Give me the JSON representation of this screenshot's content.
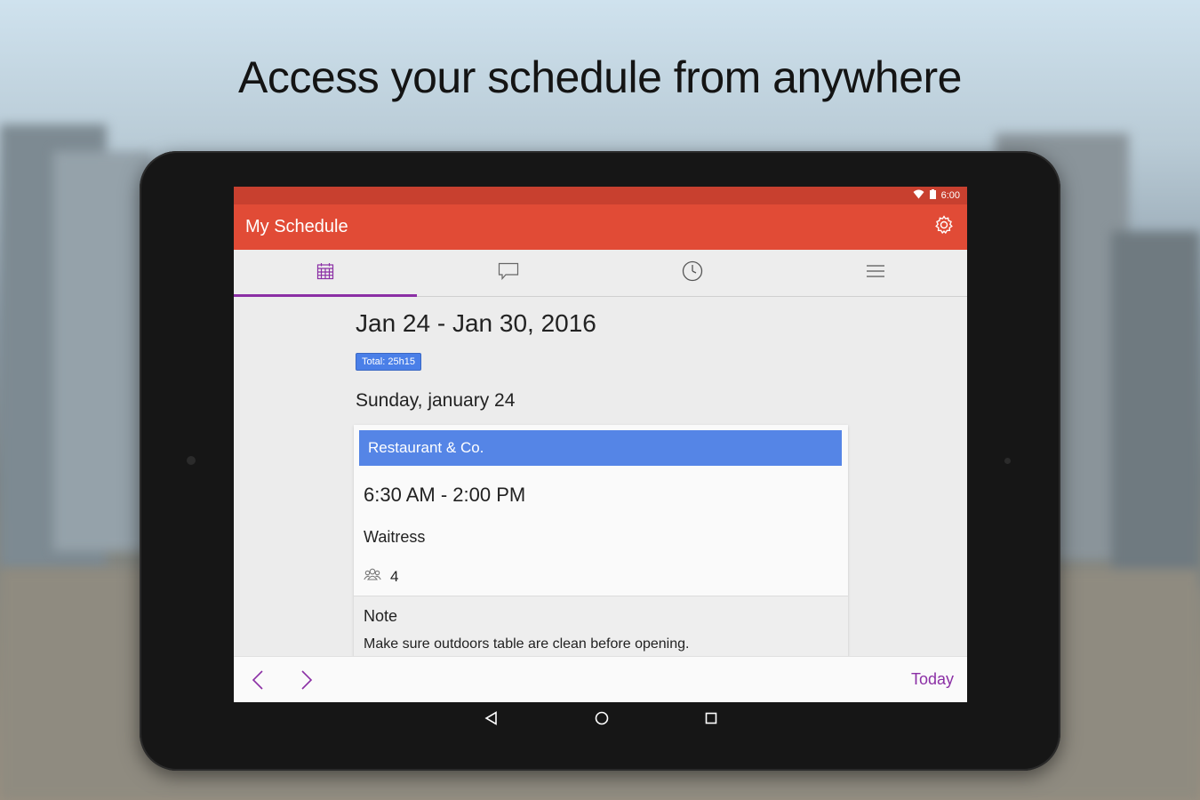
{
  "headline": "Access your schedule from anywhere",
  "status_bar": {
    "time": "6:00"
  },
  "app_bar": {
    "title": "My Schedule"
  },
  "tabs": [
    {
      "name": "schedule",
      "icon": "calendar-icon",
      "active": true
    },
    {
      "name": "messages",
      "icon": "chat-icon",
      "active": false
    },
    {
      "name": "timeclock",
      "icon": "clock-icon",
      "active": false
    },
    {
      "name": "menu",
      "icon": "hamburger-menu-icon",
      "active": false
    }
  ],
  "schedule": {
    "week_range": "Jan 24 - Jan 30, 2016",
    "total_badge": "Total: 25h15",
    "day_heading": "Sunday, january 24",
    "shift": {
      "location": "Restaurant & Co.",
      "time": "6:30 AM - 2:00 PM",
      "role": "Waitress",
      "people_count": "4",
      "note_title": "Note",
      "note_text": "Make sure outdoors table are clean before opening."
    }
  },
  "bottom_bar": {
    "today_label": "Today"
  },
  "colors": {
    "status_bar": "#c8402f",
    "app_bar": "#e14b36",
    "accent_purple": "#8b2fa5",
    "card_header_blue": "#5585e6",
    "badge_blue": "#4a7fe8"
  }
}
